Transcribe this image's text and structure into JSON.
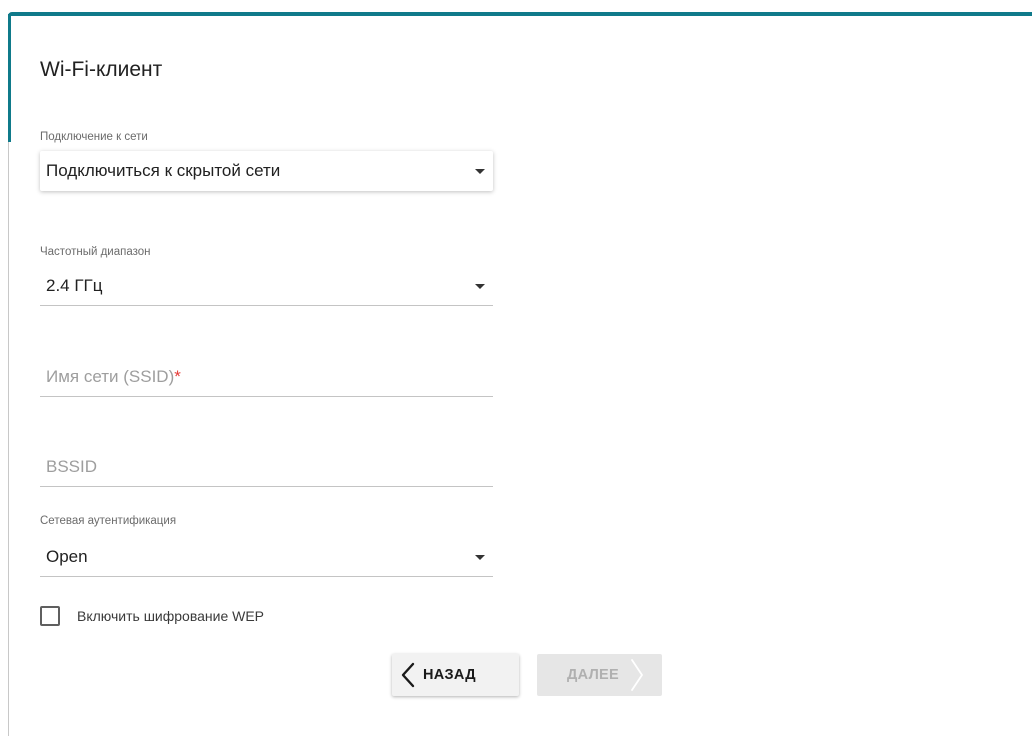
{
  "page": {
    "title": "Wi-Fi-клиент"
  },
  "form": {
    "network_connection": {
      "label": "Подключение к сети",
      "value": "Подключиться к скрытой сети"
    },
    "frequency_band": {
      "label": "Частотный диапазон",
      "value": "2.4 ГГц"
    },
    "ssid": {
      "placeholder": "Имя сети (SSID)",
      "required_mark": "*",
      "value": ""
    },
    "bssid": {
      "placeholder": "BSSID",
      "value": ""
    },
    "authentication": {
      "label": "Сетевая аутентификация",
      "value": "Open"
    },
    "wep_checkbox": {
      "label": "Включить шифрование WEP",
      "checked": false
    }
  },
  "buttons": {
    "back_label": "НАЗАД",
    "next_label": "ДАЛЕЕ",
    "next_disabled": true
  },
  "colors": {
    "accent": "#0f7a8a",
    "required": "#e53935"
  },
  "icons": {
    "back": "chevron-left-icon",
    "next": "chevron-right-icon",
    "dropdown": "caret-down-icon"
  }
}
